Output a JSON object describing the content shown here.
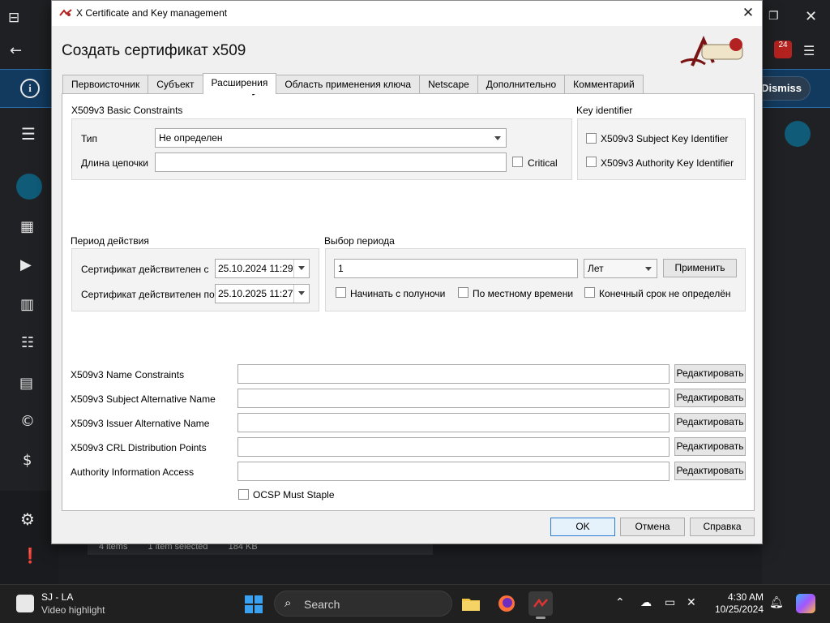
{
  "dialog": {
    "window_title": "X Certificate and Key management",
    "heading": "Создать сертификат x509",
    "tabs": [
      "Первоисточник",
      "Субъект",
      "Расширения",
      "Область применения ключа",
      "Netscape",
      "Дополнительно",
      "Комментарий"
    ],
    "active_tab": "Расширения",
    "basic_constraints": {
      "title": "X509v3 Basic Constraints",
      "type_label": "Тип",
      "type_value": "Не определен",
      "path_len_label": "Длина цепочки",
      "path_len_value": "",
      "critical_label": "Critical"
    },
    "key_identifier": {
      "title": "Key identifier",
      "subject_label": "X509v3 Subject Key Identifier",
      "authority_label": "X509v3 Authority Key Identifier"
    },
    "validity": {
      "title": "Период действия",
      "from_label": "Сертификат действителен с",
      "from_value": "25.10.2024 11:29",
      "to_label": "Сертификат действителен по",
      "to_value": "25.10.2025 11:27"
    },
    "period": {
      "title": "Выбор периода",
      "amount": "1",
      "unit": "Лет",
      "apply_label": "Применить",
      "midnight_label": "Начинать с полуночи",
      "local_time_label": "По местному времени",
      "no_end_label": "Конечный срок не определён"
    },
    "extensions": [
      {
        "label": "X509v3 Name Constraints",
        "value": "",
        "button": "Редактировать"
      },
      {
        "label": "X509v3 Subject Alternative Name",
        "value": "",
        "button": "Редактировать"
      },
      {
        "label": "X509v3 Issuer Alternative Name",
        "value": "",
        "button": "Редактировать"
      },
      {
        "label": "X509v3 CRL Distribution Points",
        "value": "",
        "button": "Редактировать"
      },
      {
        "label": "Authority Information Access",
        "value": "",
        "button": "Редактировать"
      }
    ],
    "ocsp_label": "OCSP Must Staple",
    "buttons": {
      "ok": "OK",
      "cancel": "Отмена",
      "help": "Справка"
    }
  },
  "background": {
    "dismiss": "Dismiss",
    "notification_count": "24",
    "status_items": "4 items",
    "status_selected": "1 item selected",
    "status_size": "184 KB"
  },
  "taskbar": {
    "news_title": "SJ - LA",
    "news_subtitle": "Video highlight",
    "search_placeholder": "Search",
    "time": "4:30 AM",
    "date": "10/25/2024"
  }
}
